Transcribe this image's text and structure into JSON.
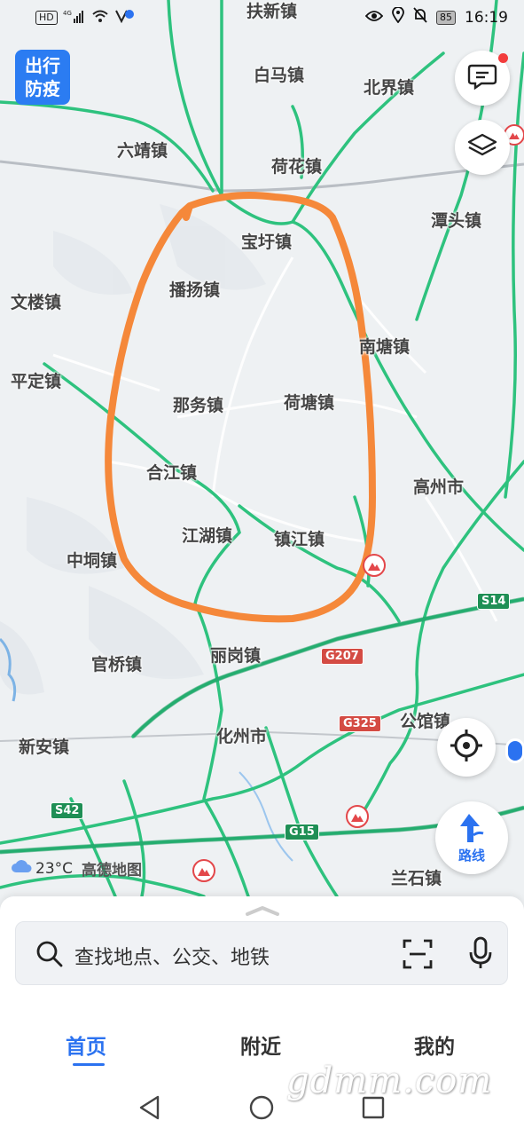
{
  "status_bar": {
    "left_icons": [
      "hd-icon",
      "signal-4g-icon",
      "wifi-icon",
      "nfc-icon"
    ],
    "battery": "85",
    "time": "16:19"
  },
  "epidemic_button": {
    "line1": "出行",
    "line2": "防疫"
  },
  "map": {
    "towns": [
      {
        "name": "扶新镇"
      },
      {
        "name": "白马镇"
      },
      {
        "name": "北界镇"
      },
      {
        "name": "六靖镇"
      },
      {
        "name": "荷花镇"
      },
      {
        "name": "潭头镇"
      },
      {
        "name": "宝圩镇"
      },
      {
        "name": "播扬镇"
      },
      {
        "name": "文楼镇"
      },
      {
        "name": "南塘镇"
      },
      {
        "name": "平定镇"
      },
      {
        "name": "那务镇"
      },
      {
        "name": "荷塘镇"
      },
      {
        "name": "高州市"
      },
      {
        "name": "合江镇"
      },
      {
        "name": "江湖镇"
      },
      {
        "name": "镇江镇"
      },
      {
        "name": "中垌镇"
      },
      {
        "name": "官桥镇"
      },
      {
        "name": "丽岗镇"
      },
      {
        "name": "公馆镇"
      },
      {
        "name": "化州市"
      },
      {
        "name": "新安镇"
      },
      {
        "name": "兰石镇"
      }
    ],
    "highways": [
      {
        "label": "S14",
        "type": "provincial"
      },
      {
        "label": "G207",
        "type": "national"
      },
      {
        "label": "G325",
        "type": "national"
      },
      {
        "label": "S42",
        "type": "provincial"
      },
      {
        "label": "G15",
        "type": "expressway"
      }
    ],
    "annotation_color": "#f5883a",
    "road_color": "#2ec27e"
  },
  "controls": {
    "feedback_icon": "message-icon",
    "layers_icon": "layers-icon",
    "locate_icon": "crosshair-icon",
    "route_label": "路线"
  },
  "weather": {
    "temperature": "23°C",
    "logo": "高德地图"
  },
  "search": {
    "placeholder": "查找地点、公交、地铁"
  },
  "tabs": [
    {
      "label": "首页",
      "active": true
    },
    {
      "label": "附近",
      "active": false
    },
    {
      "label": "我的",
      "active": false
    }
  ],
  "watermark": "gdmm.com",
  "system_nav": [
    "back-icon",
    "home-icon",
    "recents-icon"
  ]
}
